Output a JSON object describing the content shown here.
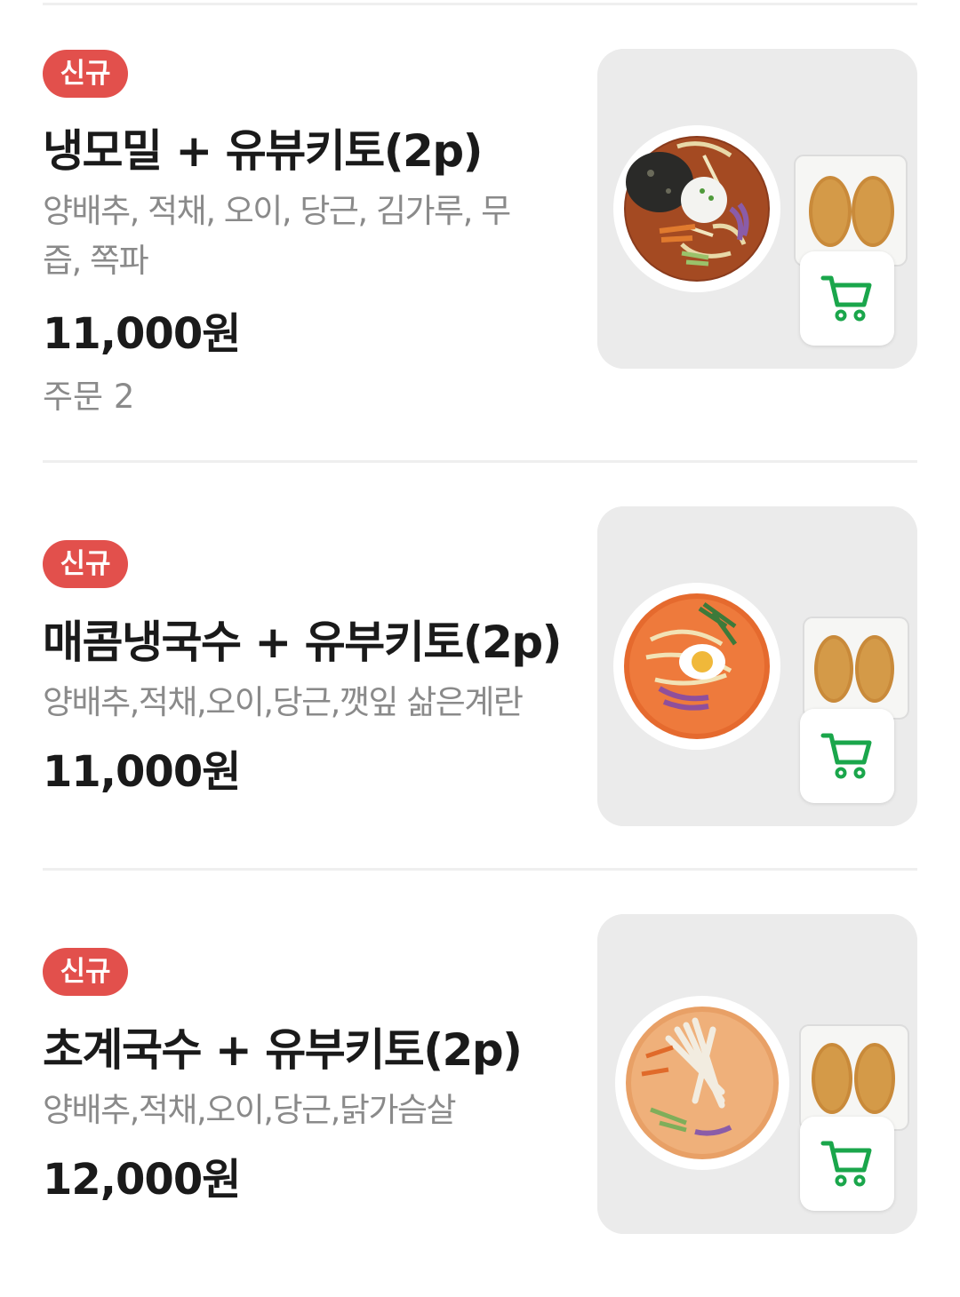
{
  "menu_items": [
    {
      "badge": "신규",
      "title": "냉모밀 + 유뷰키토(2p)",
      "description": "양배추, 적채, 오이, 당근, 김가루, 무즙, 쪽파",
      "price": "11,000원",
      "orders": "주문 2",
      "image_icon": "soba-with-inari-image",
      "cart_icon": "cart-icon"
    },
    {
      "badge": "신규",
      "title": "매콤냉국수 + 유부키토(2p)",
      "description": "양배추,적채,오이,당근,깻잎 삶은계란",
      "price": "11,000원",
      "image_icon": "spicy-noodle-with-inari-image",
      "cart_icon": "cart-icon"
    },
    {
      "badge": "신규",
      "title": "초계국수 + 유부키토(2p)",
      "description": "양배추,적채,오이,당근,닭가슴살",
      "price": "12,000원",
      "image_icon": "chicken-noodle-with-inari-image",
      "cart_icon": "cart-icon"
    }
  ],
  "colors": {
    "badge": "#e2504c",
    "cart": "#1aa64b",
    "divider": "#efefef",
    "secondary_text": "#8a8a8a"
  }
}
